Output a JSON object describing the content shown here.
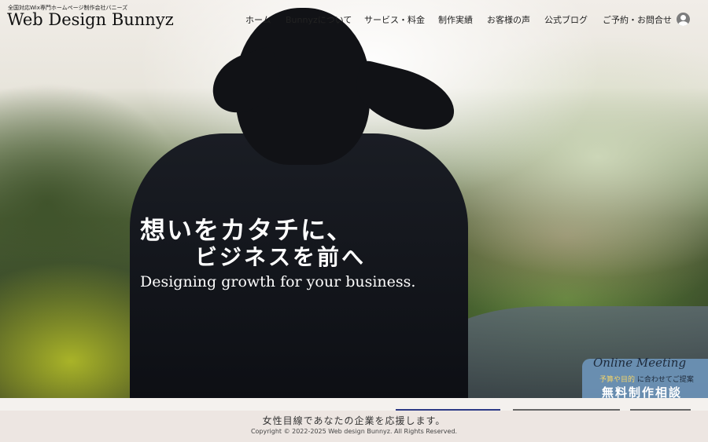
{
  "header": {
    "tagline": "全国対応Wix専門ホームページ制作会社バニーズ",
    "logo": "Web Design Bunnyz"
  },
  "nav": {
    "items": [
      {
        "label": "ホーム",
        "active": true
      },
      {
        "label": "Bunnyzについて"
      },
      {
        "label": "サービス・料金"
      },
      {
        "label": "制作実績"
      },
      {
        "label": "お客様の声"
      },
      {
        "label": "公式ブログ"
      },
      {
        "label": "ご予約・お問合せ"
      }
    ],
    "account_icon": "user-account-icon"
  },
  "hero": {
    "line1": "想いをカタチに、",
    "line2": "ビジネスを前へ",
    "line3": "Designing growth for your business."
  },
  "cta": {
    "script": "Online Meeting",
    "sub_highlight": "予算や目的",
    "sub_rest": "に合わせてご提案",
    "main": "無料制作相談"
  },
  "footer": {
    "message": "女性目線であなたの企業を応援します。",
    "copyright": "Copyright © 2022-2025 Web design Bunnyz. All Rights Reserved."
  },
  "colors": {
    "cta_bg": "#6c94b9",
    "cta_highlight": "#f1d36a",
    "footer_bg": "#ede6e2",
    "nav_active": "#888888"
  }
}
